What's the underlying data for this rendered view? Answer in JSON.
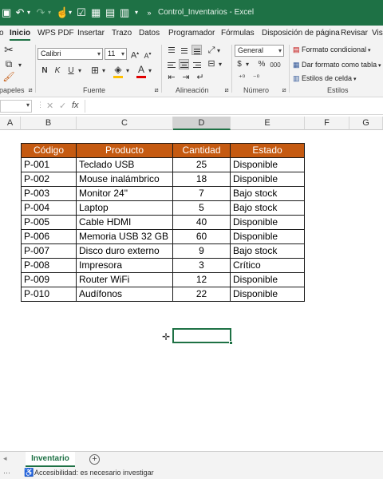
{
  "titlebar": {
    "title": "Control_Inventarios  -  Excel",
    "icons": [
      "save-icon",
      "undo-icon",
      "redo-icon",
      "touch-mode-icon",
      "check-box-icon",
      "table-icon",
      "grid-icon",
      "customize-icon"
    ]
  },
  "tabs": [
    "o",
    "Inicio",
    "WPS PDF",
    "Insertar",
    "Trazo",
    "Datos",
    "Programador",
    "Fórmulas",
    "Disposición de página",
    "Revisar",
    "Vis"
  ],
  "active_tab": "Inicio",
  "ribbon": {
    "font_name": "Calibri",
    "font_size": "11",
    "grow_font": "A",
    "shrink_font": "A",
    "bold": "N",
    "italic": "K",
    "underline": "U",
    "number_format": "General",
    "currency": "$",
    "percent": "%",
    "comma": "000",
    "conditional_format": "Formato condicional",
    "format_as_table": "Dar formato como tabla",
    "cell_styles": "Estilos de celda",
    "groups": {
      "clipboard": "papeles",
      "font": "Fuente",
      "alignment": "Alineación",
      "number": "Número",
      "styles": "Estilos"
    }
  },
  "formula_bar": {
    "fx": "fx",
    "cancel": "✕",
    "enter": "✓",
    "value": ""
  },
  "columns": [
    "A",
    "B",
    "C",
    "D",
    "E",
    "F",
    "G"
  ],
  "selected_column": "D",
  "table": {
    "headers": [
      "Código",
      "Producto",
      "Cantidad",
      "Estado"
    ],
    "rows": [
      [
        "P-001",
        "Teclado USB",
        "25",
        "Disponible"
      ],
      [
        "P-002",
        "Mouse inalámbrico",
        "18",
        "Disponible"
      ],
      [
        "P-003",
        "Monitor 24\"",
        "7",
        "Bajo stock"
      ],
      [
        "P-004",
        "Laptop",
        "5",
        "Bajo stock"
      ],
      [
        "P-005",
        "Cable HDMI",
        "40",
        "Disponible"
      ],
      [
        "P-006",
        "Memoria USB 32 GB",
        "60",
        "Disponible"
      ],
      [
        "P-007",
        "Disco duro externo",
        "9",
        "Bajo stock"
      ],
      [
        "P-008",
        "Impresora",
        "3",
        "Crítico"
      ],
      [
        "P-009",
        "Router WiFi",
        "12",
        "Disponible"
      ],
      [
        "P-010",
        "Audífonos",
        "22",
        "Disponible"
      ]
    ]
  },
  "sheet_tabs": [
    "Inventario"
  ],
  "add_sheet": "+",
  "status": {
    "accessibility": "Accesibilidad: es necesario investigar"
  },
  "colors": {
    "excel_green": "#1e7145",
    "header_orange": "#c55a11",
    "header_text": "#ffffff"
  }
}
